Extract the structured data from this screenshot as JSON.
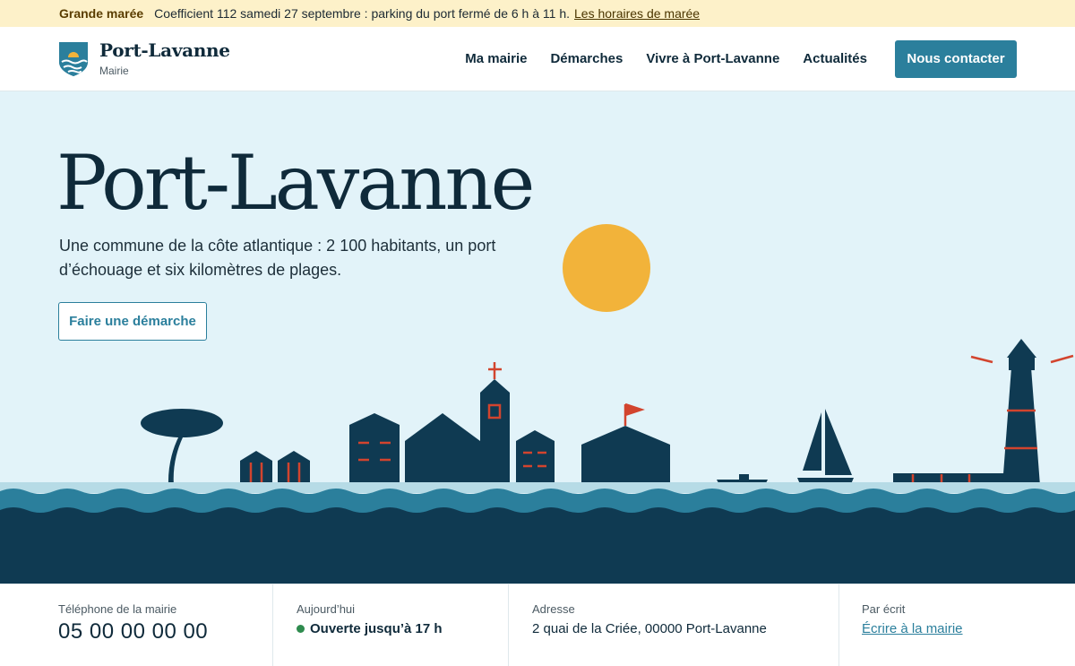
{
  "alert": {
    "tag": "Grande marée",
    "message": "Coefficient 112 samedi 27 septembre : parking du port fermé de 6 h à 11 h.",
    "link": "Les horaires de marée"
  },
  "brand": {
    "name": "Port-Lavanne",
    "subtitle": "Mairie"
  },
  "nav": {
    "items": [
      {
        "label": "Ma mairie"
      },
      {
        "label": "Démarches"
      },
      {
        "label": "Vivre à Port-Lavanne"
      },
      {
        "label": "Actualités"
      }
    ],
    "cta": "Nous contacter"
  },
  "hero": {
    "title": "Port-Lavanne",
    "lead": "Une commune de la côte atlantique : 2 100 habitants, un port d’échouage et six kilomètres de plages.",
    "button": "Faire une démarche"
  },
  "info": {
    "phone": {
      "label": "Téléphone de la mairie",
      "value": "05 00 00 00 00"
    },
    "today": {
      "label": "Aujourd’hui",
      "value": "Ouverte jusqu’à 17 h"
    },
    "address": {
      "label": "Adresse",
      "value": "2 quai de la Criée, 00000 Port-Lavanne"
    },
    "mail": {
      "label": "Par écrit",
      "value": "Écrire à la mairie"
    }
  },
  "colors": {
    "accent": "#2b7f9c",
    "navy": "#0f3a52",
    "sky": "#e2f3f9",
    "sun": "#f2b33a",
    "alert_bg": "#fdf1c9",
    "status_open": "#2e8b4e",
    "red_detail": "#d2442e"
  }
}
